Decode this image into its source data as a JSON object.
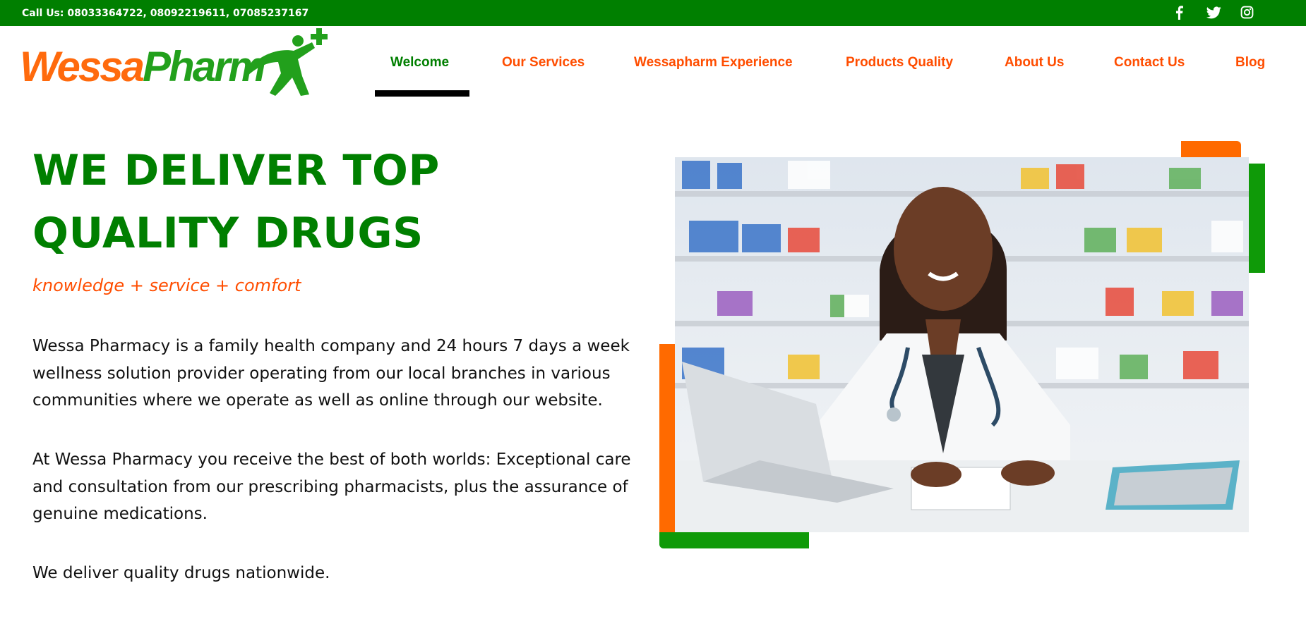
{
  "topbar": {
    "phone": "Call Us: 08033364722, 08092219611, 07085237167",
    "social": [
      "facebook-icon",
      "twitter-icon",
      "instagram-icon"
    ],
    "background": "#007f00"
  },
  "brand": {
    "wessa": "Wessa",
    "pharm": "Pharm",
    "orange": "#ff6a0d",
    "green": "#22a01c"
  },
  "nav": {
    "items": [
      {
        "label": "Welcome",
        "active": true
      },
      {
        "label": "Our Services"
      },
      {
        "label": "Wessapharm Experience"
      },
      {
        "label": "Products Quality"
      },
      {
        "label": "About Us"
      },
      {
        "label": "Contact Us"
      },
      {
        "label": "Blog"
      }
    ],
    "color": "#ff4d00",
    "active_color": "#007f00"
  },
  "hero": {
    "title": "WE DELIVER TOP QUALITY DRUGS",
    "tagline": "knowledge + service + comfort",
    "paragraphs": [
      "Wessa Pharmacy is a family health company and 24 hours 7 days a week wellness solution provider operating from our local branches in various communities where we operate as well as online through our website.",
      "At Wessa Pharmacy you receive the best of both worlds: Exceptional care and consultation from our prescribing pharmacists, plus the assurance of genuine medications.",
      "We deliver quality drugs nationwide."
    ]
  }
}
